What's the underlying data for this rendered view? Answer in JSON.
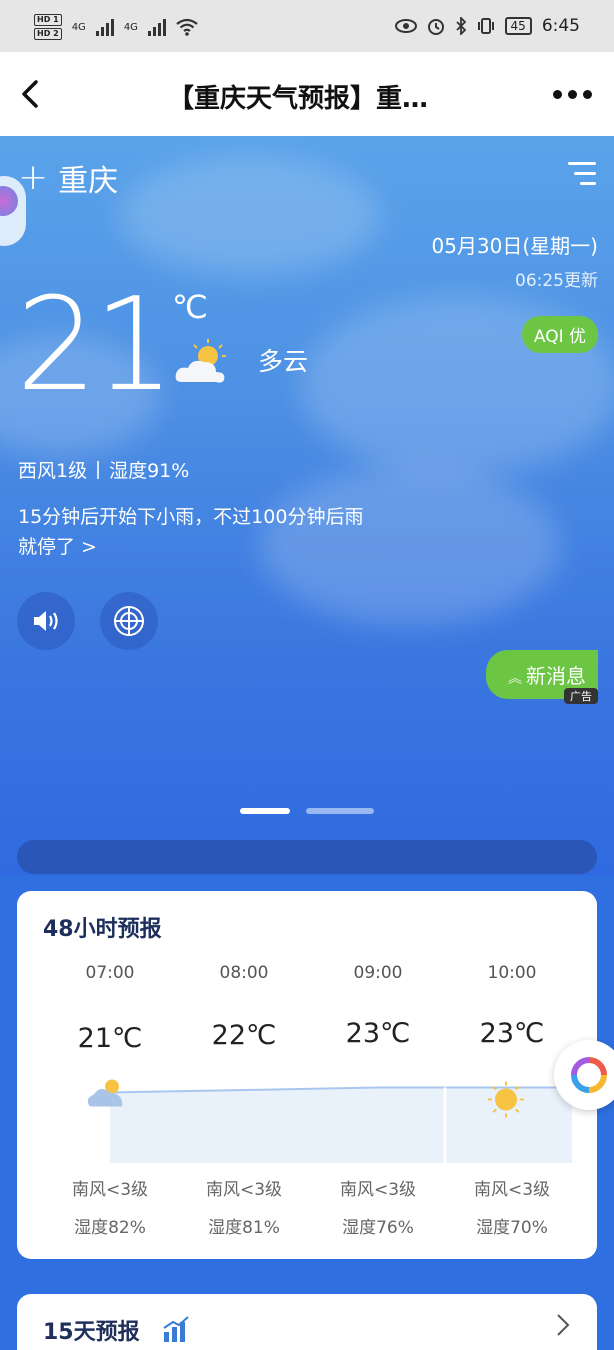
{
  "status_bar": {
    "sim1": "HD 1",
    "sim2": "HD 2",
    "net1": "4G",
    "net2": "4G",
    "battery": "45",
    "time": "6:45"
  },
  "titlebar": {
    "title": "【重庆天气预报】重…"
  },
  "hero": {
    "city": "重庆",
    "date": "05月30日(星期一)",
    "updated": "06:25更新",
    "aqi": "AQI 优",
    "temperature": "21",
    "unit": "℃",
    "condition": "多云",
    "wind": "西风1级",
    "humidity": "湿度91%",
    "forecast_message": "15分钟后开始下小雨，不过100分钟后雨就停了 >",
    "new_message": "新消息",
    "ad_tag": "广告",
    "page_indicator": {
      "count": 2,
      "active": 0
    }
  },
  "hourly_forecast": {
    "title": "48小时预报",
    "hours": [
      {
        "time": "07:00",
        "temp": "21℃",
        "temp_value": 21,
        "icon": "partly-cloudy-icon",
        "wind": "南风<3级",
        "humidity": "湿度82%"
      },
      {
        "time": "08:00",
        "temp": "22℃",
        "temp_value": 22,
        "icon": "",
        "wind": "南风<3级",
        "humidity": "湿度81%"
      },
      {
        "time": "09:00",
        "temp": "23℃",
        "temp_value": 23,
        "icon": "",
        "wind": "南风<3级",
        "humidity": "湿度76%"
      },
      {
        "time": "10:00",
        "temp": "23℃",
        "temp_value": 23,
        "icon": "sun-icon",
        "wind": "南风<3级",
        "humidity": "湿度70%"
      }
    ]
  },
  "daily_forecast": {
    "title": "15天预报"
  },
  "colors": {
    "accent_green": "#6cc644",
    "sky_top": "#5aa3ea",
    "page_blue": "#2f6fe0",
    "card_title": "#1f2f5c"
  }
}
